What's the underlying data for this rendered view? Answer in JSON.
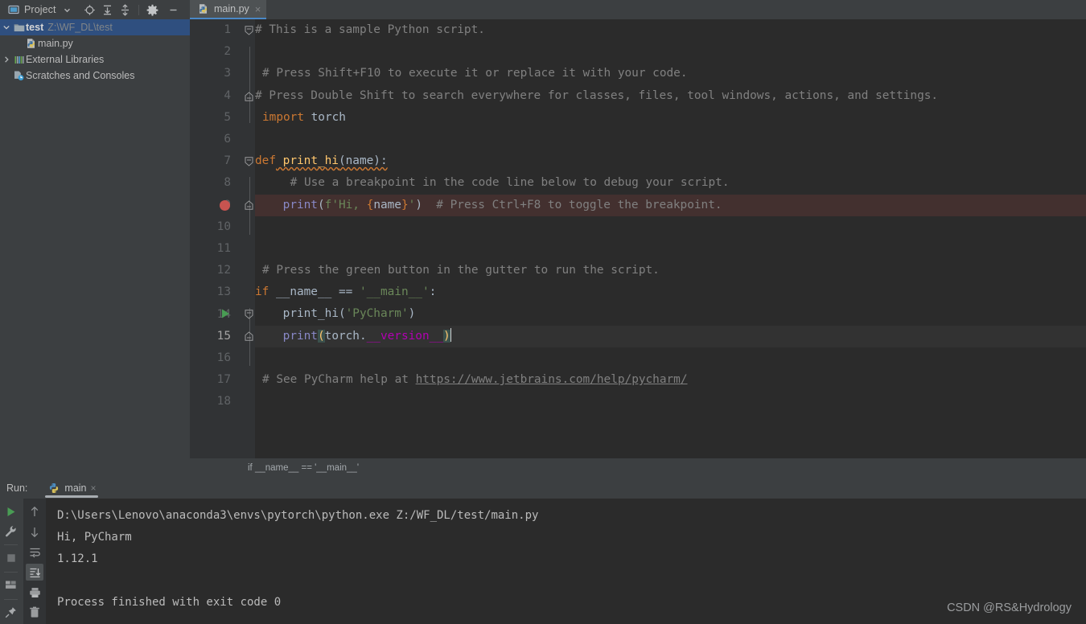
{
  "toolbar": {
    "project_label": "Project",
    "icons": [
      {
        "name": "chevron-down-icon",
        "title": "Project view dropdown"
      },
      {
        "name": "locate-target-icon",
        "title": "Select Opened File"
      },
      {
        "name": "expand-all-icon",
        "title": "Expand All"
      },
      {
        "name": "collapse-all-icon",
        "title": "Collapse All"
      },
      {
        "name": "gear-icon",
        "title": "Settings"
      },
      {
        "name": "minimize-icon",
        "title": "Hide"
      }
    ]
  },
  "tabs": [
    {
      "label": "main.py",
      "icon": "python-file-icon",
      "active": true,
      "close": "×"
    }
  ],
  "sidebar": {
    "items": [
      {
        "label": "test",
        "sublabel": "Z:\\WF_DL\\test",
        "icon": "folder-icon",
        "twisty": "⌄",
        "selected": true,
        "indent": 0,
        "bold": true
      },
      {
        "label": "main.py",
        "sublabel": "",
        "icon": "python-file-icon",
        "twisty": "",
        "selected": false,
        "indent": 1,
        "bold": false
      },
      {
        "label": "External Libraries",
        "sublabel": "",
        "icon": "library-icon",
        "twisty": "›",
        "selected": false,
        "indent": 0,
        "bold": false
      },
      {
        "label": "Scratches and Consoles",
        "sublabel": "",
        "icon": "scratches-icon",
        "twisty": "",
        "selected": false,
        "indent": 0,
        "bold": false
      }
    ]
  },
  "editor": {
    "file": "main.py",
    "lines": [
      {
        "num": "1",
        "text": "# This is a sample Python script."
      },
      {
        "num": "2",
        "text": ""
      },
      {
        "num": "3",
        "text": "# Press Shift+F10 to execute it or replace it with your code."
      },
      {
        "num": "4",
        "text": "# Press Double Shift to search everywhere for classes, files, tool windows, actions, and settings."
      },
      {
        "num": "5",
        "text": "import torch"
      },
      {
        "num": "6",
        "text": ""
      },
      {
        "num": "7",
        "text": "def print_hi(name):"
      },
      {
        "num": "8",
        "text": "    # Use a breakpoint in the code line below to debug your script."
      },
      {
        "num": "9",
        "text": "    print(f'Hi, {name}')  # Press Ctrl+F8 to toggle the breakpoint."
      },
      {
        "num": "10",
        "text": ""
      },
      {
        "num": "11",
        "text": ""
      },
      {
        "num": "12",
        "text": "# Press the green button in the gutter to run the script."
      },
      {
        "num": "13",
        "text": "if __name__ == '__main__':"
      },
      {
        "num": "14",
        "text": "    print_hi('PyCharm')"
      },
      {
        "num": "15",
        "text": "    print(torch.__version__)"
      },
      {
        "num": "16",
        "text": ""
      },
      {
        "num": "17",
        "text": "# See PyCharm help at https://www.jetbrains.com/help/pycharm/"
      },
      {
        "num": "18",
        "text": ""
      }
    ],
    "breakpoint_line": "9",
    "run_marker_line": "13",
    "caret_line": "15",
    "link_url": "https://www.jetbrains.com/help/pycharm/",
    "breadcrumb": "if __name__ == '__main__'"
  },
  "run_panel": {
    "label": "Run:",
    "tab_name": "main",
    "tab_icon": "python-icon",
    "tab_close": "×",
    "left_icons": [
      {
        "name": "rerun-icon"
      },
      {
        "name": "settings-wrench-icon"
      },
      {
        "name": "stop-icon"
      },
      {
        "name": "layout-icon"
      },
      {
        "name": "pin-icon"
      }
    ],
    "right_icons": [
      {
        "name": "arrow-up-icon"
      },
      {
        "name": "arrow-down-icon"
      },
      {
        "name": "soft-wrap-icon"
      },
      {
        "name": "scroll-to-end-icon"
      },
      {
        "name": "print-icon"
      },
      {
        "name": "trash-icon"
      }
    ],
    "output": [
      "D:\\Users\\Lenovo\\anaconda3\\envs\\pytorch\\python.exe Z:/WF_DL/test/main.py",
      "Hi, PyCharm",
      "1.12.1",
      "",
      "Process finished with exit code 0"
    ]
  },
  "watermark": "CSDN @RS&Hydrology",
  "colors": {
    "editor_bg": "#2b2b2b",
    "panel_bg": "#3c3f41",
    "gutter_bg": "#313335",
    "selection_blue": "#2f4f7f",
    "tab_underline": "#4a88c7",
    "breakpoint_red": "#c75450",
    "breakpoint_line_bg": "#43302f",
    "run_green": "#499c54",
    "keyword_orange": "#cc7832",
    "string_green": "#6a8759",
    "function_yellow": "#ffc66d",
    "comment_gray": "#808080",
    "builtin_purple": "#8888c6",
    "dunder_magenta": "#b200b2",
    "text_fg": "#a9b7c6"
  }
}
